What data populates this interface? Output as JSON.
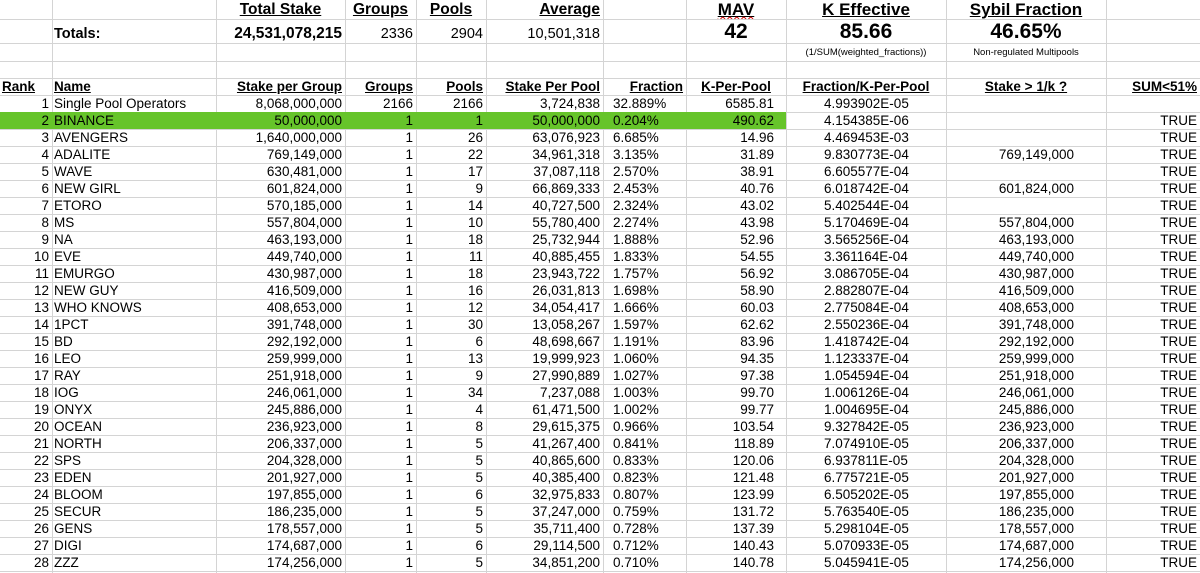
{
  "summary": {
    "total_stake_label": "Total Stake",
    "groups_label": "Groups",
    "pools_label": "Pools",
    "average_label": "Average",
    "mav_label": "MAV",
    "k_effective_label": "K Effective",
    "sybil_fraction_label": "Sybil Fraction",
    "totals_label": "Totals:",
    "total_stake": "24,531,078,215",
    "groups": "2336",
    "pools": "2904",
    "average": "10,501,318",
    "mav": "42",
    "k_effective": "85.66",
    "sybil_fraction": "46.65%",
    "k_effective_note": "(1/SUM(weighted_fractions))",
    "sybil_note": "Non-regulated Multipools"
  },
  "columns": [
    "Rank",
    "Name",
    "Stake per Group",
    "Groups",
    "Pools",
    "Stake Per Pool",
    "Fraction",
    "K-Per-Pool",
    "Fraction/K-Per-Pool",
    "Stake > 1/k ?",
    "SUM<51%"
  ],
  "highlight_color": "#66c42a",
  "rows": [
    [
      "1",
      "Single Pool Operators",
      "8,068,000,000",
      "2166",
      "2166",
      "3,724,838",
      "32.889%",
      "6585.81",
      "4.993902E-05",
      "",
      ""
    ],
    [
      "2",
      "BINANCE",
      "50,000,000",
      "1",
      "1",
      "50,000,000",
      "0.204%",
      "490.62",
      "4.154385E-06",
      "",
      "TRUE"
    ],
    [
      "3",
      "AVENGERS",
      "1,640,000,000",
      "1",
      "26",
      "63,076,923",
      "6.685%",
      "14.96",
      "4.469453E-03",
      "",
      "TRUE"
    ],
    [
      "4",
      "ADALITE",
      "769,149,000",
      "1",
      "22",
      "34,961,318",
      "3.135%",
      "31.89",
      "9.830773E-04",
      "769,149,000",
      "TRUE"
    ],
    [
      "5",
      "WAVE",
      "630,481,000",
      "1",
      "17",
      "37,087,118",
      "2.570%",
      "38.91",
      "6.605577E-04",
      "",
      "TRUE"
    ],
    [
      "6",
      "NEW GIRL",
      "601,824,000",
      "1",
      "9",
      "66,869,333",
      "2.453%",
      "40.76",
      "6.018742E-04",
      "601,824,000",
      "TRUE"
    ],
    [
      "7",
      "ETORO",
      "570,185,000",
      "1",
      "14",
      "40,727,500",
      "2.324%",
      "43.02",
      "5.402544E-04",
      "",
      "TRUE"
    ],
    [
      "8",
      "MS",
      "557,804,000",
      "1",
      "10",
      "55,780,400",
      "2.274%",
      "43.98",
      "5.170469E-04",
      "557,804,000",
      "TRUE"
    ],
    [
      "9",
      "NA",
      "463,193,000",
      "1",
      "18",
      "25,732,944",
      "1.888%",
      "52.96",
      "3.565256E-04",
      "463,193,000",
      "TRUE"
    ],
    [
      "10",
      "EVE",
      "449,740,000",
      "1",
      "11",
      "40,885,455",
      "1.833%",
      "54.55",
      "3.361164E-04",
      "449,740,000",
      "TRUE"
    ],
    [
      "11",
      "EMURGO",
      "430,987,000",
      "1",
      "18",
      "23,943,722",
      "1.757%",
      "56.92",
      "3.086705E-04",
      "430,987,000",
      "TRUE"
    ],
    [
      "12",
      "NEW GUY",
      "416,509,000",
      "1",
      "16",
      "26,031,813",
      "1.698%",
      "58.90",
      "2.882807E-04",
      "416,509,000",
      "TRUE"
    ],
    [
      "13",
      "WHO KNOWS",
      "408,653,000",
      "1",
      "12",
      "34,054,417",
      "1.666%",
      "60.03",
      "2.775084E-04",
      "408,653,000",
      "TRUE"
    ],
    [
      "14",
      "1PCT",
      "391,748,000",
      "1",
      "30",
      "13,058,267",
      "1.597%",
      "62.62",
      "2.550236E-04",
      "391,748,000",
      "TRUE"
    ],
    [
      "15",
      "BD",
      "292,192,000",
      "1",
      "6",
      "48,698,667",
      "1.191%",
      "83.96",
      "1.418742E-04",
      "292,192,000",
      "TRUE"
    ],
    [
      "16",
      "LEO",
      "259,999,000",
      "1",
      "13",
      "19,999,923",
      "1.060%",
      "94.35",
      "1.123337E-04",
      "259,999,000",
      "TRUE"
    ],
    [
      "17",
      "RAY",
      "251,918,000",
      "1",
      "9",
      "27,990,889",
      "1.027%",
      "97.38",
      "1.054594E-04",
      "251,918,000",
      "TRUE"
    ],
    [
      "18",
      "IOG",
      "246,061,000",
      "1",
      "34",
      "7,237,088",
      "1.003%",
      "99.70",
      "1.006126E-04",
      "246,061,000",
      "TRUE"
    ],
    [
      "19",
      "ONYX",
      "245,886,000",
      "1",
      "4",
      "61,471,500",
      "1.002%",
      "99.77",
      "1.004695E-04",
      "245,886,000",
      "TRUE"
    ],
    [
      "20",
      "OCEAN",
      "236,923,000",
      "1",
      "8",
      "29,615,375",
      "0.966%",
      "103.54",
      "9.327842E-05",
      "236,923,000",
      "TRUE"
    ],
    [
      "21",
      "NORTH",
      "206,337,000",
      "1",
      "5",
      "41,267,400",
      "0.841%",
      "118.89",
      "7.074910E-05",
      "206,337,000",
      "TRUE"
    ],
    [
      "22",
      "SPS",
      "204,328,000",
      "1",
      "5",
      "40,865,600",
      "0.833%",
      "120.06",
      "6.937811E-05",
      "204,328,000",
      "TRUE"
    ],
    [
      "23",
      "EDEN",
      "201,927,000",
      "1",
      "5",
      "40,385,400",
      "0.823%",
      "121.48",
      "6.775721E-05",
      "201,927,000",
      "TRUE"
    ],
    [
      "24",
      "BLOOM",
      "197,855,000",
      "1",
      "6",
      "32,975,833",
      "0.807%",
      "123.99",
      "6.505202E-05",
      "197,855,000",
      "TRUE"
    ],
    [
      "25",
      "SECUR",
      "186,235,000",
      "1",
      "5",
      "37,247,000",
      "0.759%",
      "131.72",
      "5.763540E-05",
      "186,235,000",
      "TRUE"
    ],
    [
      "26",
      "GENS",
      "178,557,000",
      "1",
      "5",
      "35,711,400",
      "0.728%",
      "137.39",
      "5.298104E-05",
      "178,557,000",
      "TRUE"
    ],
    [
      "27",
      "DIGI",
      "174,687,000",
      "1",
      "6",
      "29,114,500",
      "0.712%",
      "140.43",
      "5.070933E-05",
      "174,687,000",
      "TRUE"
    ],
    [
      "28",
      "ZZZ",
      "174,256,000",
      "1",
      "5",
      "34,851,200",
      "0.710%",
      "140.78",
      "5.045941E-05",
      "174,256,000",
      "TRUE"
    ]
  ]
}
